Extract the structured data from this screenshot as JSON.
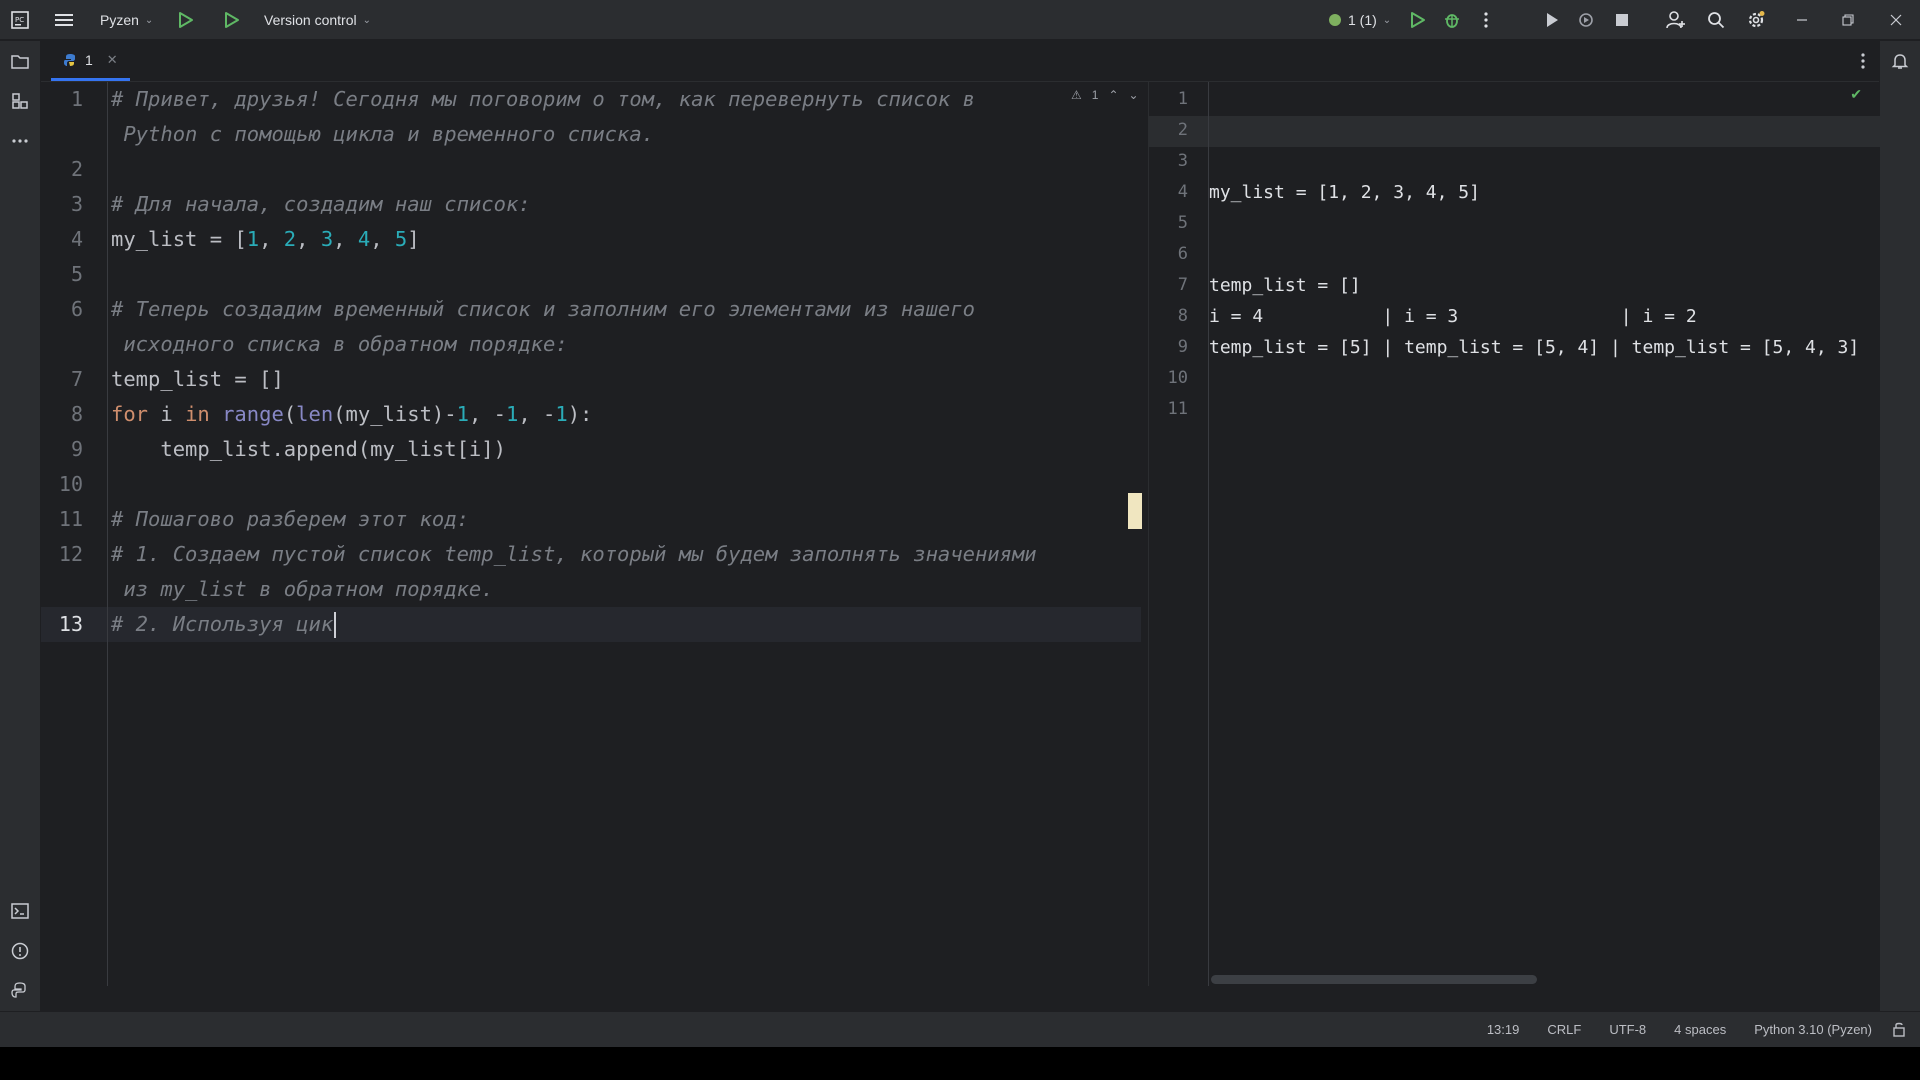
{
  "titlebar": {
    "project": "Pyzen",
    "vcs": "Version control",
    "run_config": "1 (1)"
  },
  "tab": {
    "label": "1"
  },
  "editor": {
    "inspection": "1",
    "caret_line": 13,
    "lines": [
      {
        "n": "1",
        "parts": [
          {
            "t": "# Привет, друзья! Сегодня мы поговорим о том, как перевернуть список в",
            "c": "cmt"
          }
        ]
      },
      {
        "n": "",
        "parts": [
          {
            "t": " Python с помощью цикла и временного списка.",
            "c": "cmt"
          }
        ]
      },
      {
        "n": "2",
        "parts": []
      },
      {
        "n": "3",
        "parts": [
          {
            "t": "# Для начала, создадим наш список:",
            "c": "cmt"
          }
        ]
      },
      {
        "n": "4",
        "parts": [
          {
            "t": "my_list = [",
            "c": ""
          },
          {
            "t": "1",
            "c": "num"
          },
          {
            "t": ", ",
            "c": ""
          },
          {
            "t": "2",
            "c": "num"
          },
          {
            "t": ", ",
            "c": ""
          },
          {
            "t": "3",
            "c": "num"
          },
          {
            "t": ", ",
            "c": ""
          },
          {
            "t": "4",
            "c": "num"
          },
          {
            "t": ", ",
            "c": ""
          },
          {
            "t": "5",
            "c": "num"
          },
          {
            "t": "]",
            "c": ""
          }
        ]
      },
      {
        "n": "5",
        "parts": []
      },
      {
        "n": "6",
        "parts": [
          {
            "t": "# Теперь создадим временный список и заполним его элементами из нашего",
            "c": "cmt"
          }
        ]
      },
      {
        "n": "",
        "parts": [
          {
            "t": " исходного списка в обратном порядке:",
            "c": "cmt"
          }
        ]
      },
      {
        "n": "7",
        "parts": [
          {
            "t": "temp_list = []",
            "c": ""
          }
        ]
      },
      {
        "n": "8",
        "parts": [
          {
            "t": "for",
            "c": "kw"
          },
          {
            "t": " i ",
            "c": ""
          },
          {
            "t": "in",
            "c": "kw"
          },
          {
            "t": " ",
            "c": ""
          },
          {
            "t": "range",
            "c": "bi"
          },
          {
            "t": "(",
            "c": ""
          },
          {
            "t": "len",
            "c": "bi"
          },
          {
            "t": "(my_list)-",
            "c": ""
          },
          {
            "t": "1",
            "c": "num"
          },
          {
            "t": ", -",
            "c": ""
          },
          {
            "t": "1",
            "c": "num"
          },
          {
            "t": ", -",
            "c": ""
          },
          {
            "t": "1",
            "c": "num"
          },
          {
            "t": "):",
            "c": ""
          }
        ]
      },
      {
        "n": "9",
        "parts": [
          {
            "t": "    temp_list.append(my_list[i])",
            "c": ""
          }
        ]
      },
      {
        "n": "10",
        "parts": []
      },
      {
        "n": "11",
        "parts": [
          {
            "t": "# Пошагово разберем этот код:",
            "c": "cmt"
          }
        ]
      },
      {
        "n": "12",
        "parts": [
          {
            "t": "# 1. Создаем пустой список temp_list, который мы будем заполнять значениями",
            "c": "cmt"
          }
        ]
      },
      {
        "n": "",
        "parts": [
          {
            "t": " из my_list в обратном порядке.",
            "c": "cmt"
          }
        ]
      },
      {
        "n": "13",
        "parts": [
          {
            "t": "# 2. Используя цик",
            "c": "cmt"
          }
        ]
      }
    ]
  },
  "results": {
    "lines": [
      {
        "n": "1",
        "text": ""
      },
      {
        "n": "2",
        "text": ""
      },
      {
        "n": "3",
        "text": ""
      },
      {
        "n": "4",
        "text": "my_list = [1, 2, 3, 4, 5]"
      },
      {
        "n": "5",
        "text": ""
      },
      {
        "n": "6",
        "text": ""
      },
      {
        "n": "7",
        "text": "temp_list = []"
      },
      {
        "n": "8",
        "text": "i = 4           | i = 3               | i = 2"
      },
      {
        "n": "9",
        "text": "temp_list = [5] | temp_list = [5, 4] | temp_list = [5, 4, 3]"
      },
      {
        "n": "10",
        "text": ""
      },
      {
        "n": "11",
        "text": ""
      }
    ]
  },
  "status": {
    "position": "13:19",
    "line_sep": "CRLF",
    "encoding": "UTF-8",
    "indent": "4 spaces",
    "interpreter": "Python 3.10 (Pyzen)"
  },
  "colors": {
    "accent": "#3574f0",
    "run_green": "#5fb865",
    "comment": "#7a7e85",
    "number": "#2aacb8",
    "keyword": "#cf8e6d"
  }
}
